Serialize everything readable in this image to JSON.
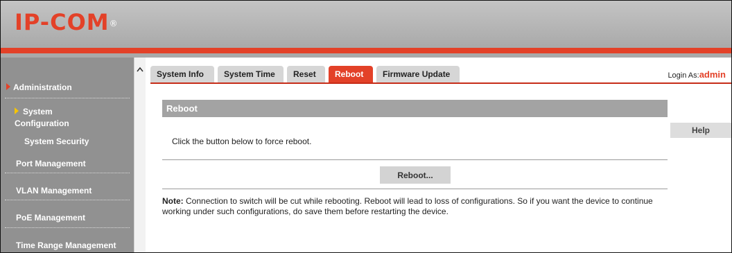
{
  "brand": {
    "logo": "IP-COM",
    "reg_mark": "®"
  },
  "colors": {
    "accent": "#e34128",
    "sidebar": "#919191",
    "panel_header": "#a3a3a3"
  },
  "sidebar": {
    "section": "Administration",
    "items": [
      {
        "line1": "System",
        "line2": "Configuration"
      },
      {
        "label": "System Security"
      },
      {
        "label": "Port Management"
      },
      {
        "label": "VLAN Management"
      },
      {
        "label": "PoE Management"
      },
      {
        "label": "Time Range Management"
      }
    ]
  },
  "tabs": [
    {
      "label": "System Info",
      "active": false
    },
    {
      "label": "System Time",
      "active": false
    },
    {
      "label": "Reset",
      "active": false
    },
    {
      "label": "Reboot",
      "active": true
    },
    {
      "label": "Firmware Update",
      "active": false
    }
  ],
  "login": {
    "prefix": "Login As:",
    "user": "admin"
  },
  "panel": {
    "title": "Reboot",
    "description": "Click the button below to force reboot.",
    "button_label": "Reboot...",
    "note_label": "Note:",
    "note_text": " Connection to switch will be cut while rebooting. Reboot will lead to loss of configurations. So if you want the device to continue working under such configurations, do save them before restarting the device."
  },
  "help_label": "Help"
}
